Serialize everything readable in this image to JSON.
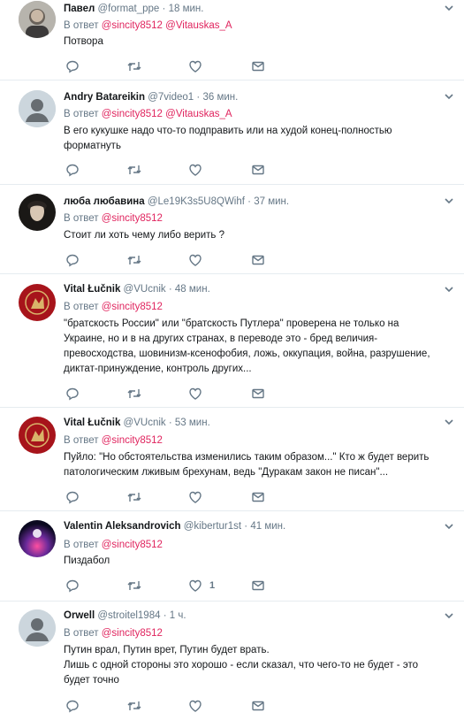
{
  "reply_prefix": "В ответ",
  "tweets": [
    {
      "name": "Павел",
      "handle": "@format_ppe",
      "time": "18 мин.",
      "mentions": [
        "@sincity8512",
        "@Vitauskas_A"
      ],
      "lines": [
        "Потвора"
      ],
      "like_count": ""
    },
    {
      "name": "Andry Batareikin",
      "handle": "@7video1",
      "time": "36 мин.",
      "mentions": [
        "@sincity8512",
        "@Vitauskas_A"
      ],
      "lines": [
        "В его кукушке надо что-то подправить или на худой конец-полностью",
        "форматнуть"
      ],
      "like_count": ""
    },
    {
      "name": "люба любавина",
      "handle": "@Le19K3s5U8QWihf",
      "time": "37 мин.",
      "mentions": [
        "@sincity8512"
      ],
      "lines": [
        "Стоит ли хоть чему либо верить ?"
      ],
      "like_count": ""
    },
    {
      "name": "Vital Łučnik",
      "handle": "@VUcnik",
      "time": "48 мин.",
      "mentions": [
        "@sincity8512"
      ],
      "lines": [
        "\"братскость России\" или \"братскость Путлера\" проверена не только на",
        "Украине, но и в на других странах, в переводе это - бред величия-",
        "превосходства, шовинизм-ксенофобия, ложь, оккупация, война, разрушение,",
        "диктат-принуждение, контроль других..."
      ],
      "like_count": ""
    },
    {
      "name": "Vital Łučnik",
      "handle": "@VUcnik",
      "time": "53 мин.",
      "mentions": [
        "@sincity8512"
      ],
      "lines": [
        "Пуйло: \"Но обстоятельства изменились таким образом...\" Кто ж будет верить",
        "патологическим лживым брехунам, ведь \"Дуракам закон не писан\"..."
      ],
      "like_count": ""
    },
    {
      "name": "Valentin Aleksandrovich",
      "handle": "@kibertur1st",
      "time": "41 мин.",
      "mentions": [
        "@sincity8512"
      ],
      "lines": [
        "Пиздабол"
      ],
      "like_count": "1"
    },
    {
      "name": "Orwell",
      "handle": "@stroitel1984",
      "time": "1 ч.",
      "mentions": [
        "@sincity8512"
      ],
      "lines": [
        "Путин врал, Путин врет, Путин будет врать.",
        "Лишь с одной стороны это хорошо - если сказал, что чего-то не будет - это",
        "будет точно"
      ],
      "like_count": ""
    }
  ],
  "colors": {
    "mention": "#e0245e",
    "meta": "#657786",
    "icon": "#657786",
    "divider": "#e6ecf0"
  },
  "icons": [
    "reply-icon",
    "retweet-icon",
    "like-icon",
    "message-icon",
    "chevron-down-icon"
  ]
}
